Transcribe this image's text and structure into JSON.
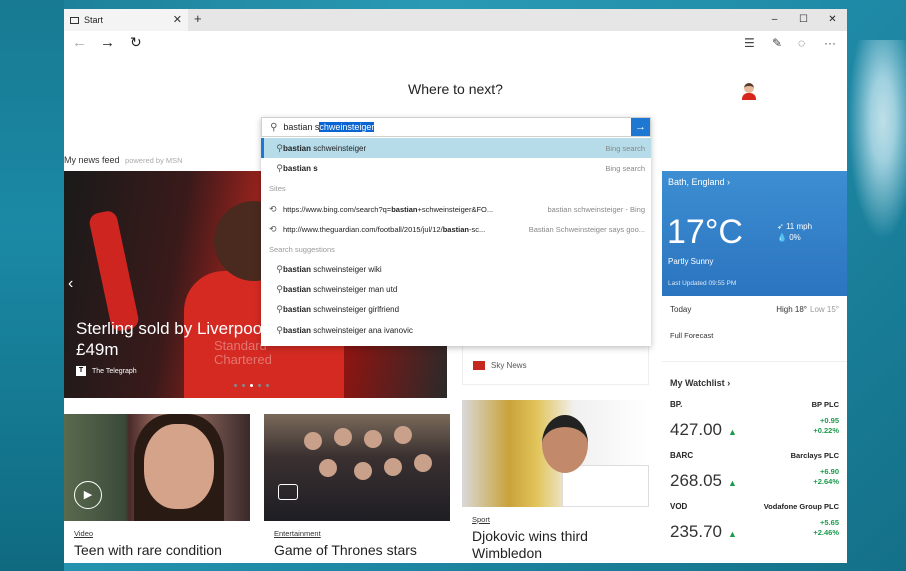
{
  "browser": {
    "tab_title": "Start",
    "new_tab_symbol": "+",
    "window_controls": {
      "minimize": "–",
      "maximize": "☐",
      "close": "✕"
    }
  },
  "start": {
    "heading": "Where to next?",
    "search_query_typed": "bastian s",
    "search_query_autocomplete": "chweinsteiger",
    "news_feed_label": "My news feed",
    "news_feed_powered": "powered by MSN"
  },
  "suggestions": {
    "top": [
      {
        "bold": "bastian",
        "rest": " schweinsteiger",
        "right": "Bing search"
      },
      {
        "bold": "bastian s",
        "rest": "",
        "right": "Bing search"
      }
    ],
    "sites_label": "Sites",
    "sites": [
      {
        "url_pre": "https://www.bing.com/search?q=",
        "url_bold": "bastian",
        "url_post": "+schweinsteiger&FO...",
        "right": "bastian schweinsteiger - Bing"
      },
      {
        "url_pre": "http://www.theguardian.com/football/2015/jul/12/",
        "url_bold": "bastian",
        "url_post": "-sc...",
        "right": "Bastian Schweinsteiger says goo..."
      }
    ],
    "search_label": "Search suggestions",
    "searches": [
      {
        "bold": "bastian",
        "rest": " schweinsteiger wiki"
      },
      {
        "bold": "bastian",
        "rest": " schweinsteiger man utd"
      },
      {
        "bold": "bastian",
        "rest": " schweinsteiger girlfriend"
      },
      {
        "bold": "bastian",
        "rest": " schweinsteiger ana ivanovic"
      }
    ]
  },
  "hero": {
    "headline_line1": "Sterling sold by Liverpool",
    "headline_line2": "£49m",
    "source": "The Telegraph",
    "sponsor_line1": "Standard",
    "sponsor_line2": "Chartered"
  },
  "sky": {
    "label": "Sky News"
  },
  "cards": [
    {
      "category": "Video",
      "title": "Teen with rare condition"
    },
    {
      "category": "Entertainment",
      "title": "Game of Thrones stars"
    },
    {
      "category": "Sport",
      "title_line1": "Djokovic wins third",
      "title_line2": "Wimbledon"
    }
  ],
  "weather": {
    "location": "Bath, England",
    "temperature": "17°C",
    "wind": "11 mph",
    "precip": "0%",
    "condition": "Partly Sunny",
    "updated": "Last Updated 09:55 PM",
    "day": "Today",
    "high": "High 18°",
    "low": "Low 15°",
    "full_forecast": "Full Forecast"
  },
  "watchlist": {
    "title": "My Watchlist",
    "stocks": [
      {
        "symbol": "BP.",
        "name": "BP PLC",
        "price": "427.00",
        "change": "+0.95",
        "pct": "+0.22%"
      },
      {
        "symbol": "BARC",
        "name": "Barclays PLC",
        "price": "268.05",
        "change": "+6.90",
        "pct": "+2.64%"
      },
      {
        "symbol": "VOD",
        "name": "Vodafone Group PLC",
        "price": "235.70",
        "change": "+5.65",
        "pct": "+2.46%"
      }
    ]
  },
  "icons": {
    "tab": "tab-page-icon",
    "back": "back-arrow-icon",
    "forward": "forward-arrow-icon",
    "refresh": "refresh-icon",
    "hub": "hub-icon",
    "note": "web-note-icon",
    "share": "share-icon",
    "more": "more-icon",
    "search": "magnifier-icon",
    "history": "history-icon",
    "go": "arrow-right-icon"
  },
  "colors": {
    "accent": "#1e78d2",
    "highlight": "#b6dcea",
    "stock_up": "#1c9a4c",
    "weather_bg": "#2b74bf"
  }
}
